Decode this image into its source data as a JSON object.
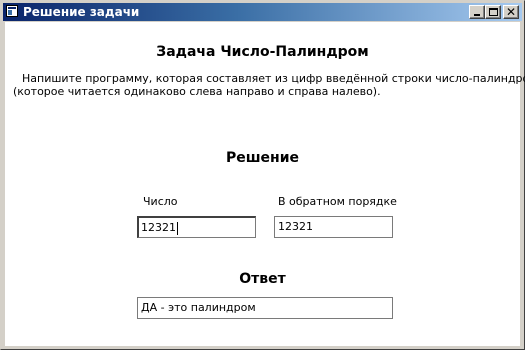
{
  "window": {
    "title": "Решение задачи",
    "icon": "app-window-icon",
    "controls": {
      "minimize": "minimize-icon",
      "maximize": "maximize-icon",
      "close": "close-icon",
      "close_glyph": "✕"
    }
  },
  "task": {
    "title": "Задача Число-Палиндром",
    "description_line1": "Напишите программу, которая составляет из цифр введённой строки число-палиндром",
    "description_line2": "(которое читается одинаково слева направо и справа налево)."
  },
  "solution": {
    "heading": "Решение",
    "number_label": "Число",
    "number_value": "12321",
    "reverse_label": "В обратном порядке",
    "reverse_value": "12321"
  },
  "answer": {
    "heading": "Ответ",
    "value": "ДА - это палиндром"
  },
  "colors": {
    "titlebar_start": "#0a246a",
    "titlebar_end": "#a6caf0",
    "window_face": "#d4d0c8",
    "client_bg": "#ffffff"
  }
}
